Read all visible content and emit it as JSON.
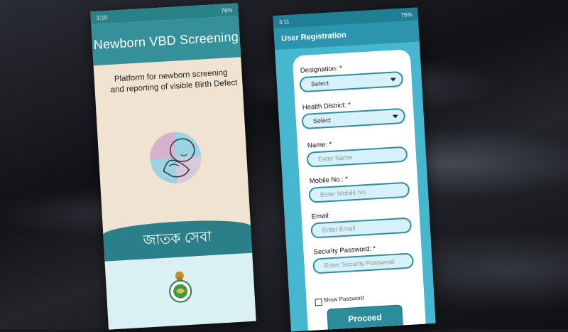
{
  "phone1": {
    "status": {
      "time": "3:10",
      "battery": "76%"
    },
    "header_title": "Newborn VBD Screening",
    "tagline_line1": "Platform for newborn screening",
    "tagline_line2": "and reporting of visible Birth Defect",
    "band_text": "জাতক সেবা"
  },
  "phone2": {
    "status": {
      "time": "3:11",
      "battery": "75%"
    },
    "header_title": "User Registration",
    "form": {
      "designation_label": "Designation: *",
      "designation_value": "Select",
      "district_label": "Health District: *",
      "district_value": "Select",
      "name_label": "Name: *",
      "name_placeholder": "Enter Name",
      "mobile_label": "Mobile No.: *",
      "mobile_placeholder": "Enter Mobile No",
      "email_label": "Email:",
      "email_placeholder": "Enter Email",
      "password_label": "Security Password: *",
      "password_placeholder": "Enter Security Password",
      "show_password_label": "Show Password",
      "proceed_label": "Proceed"
    }
  },
  "colors": {
    "teal_dark": "#2a7f88",
    "teal_header": "#34919a",
    "cream": "#f1e3d2",
    "blue_bg": "#47b6cf",
    "input_fill": "#d7f1fa"
  }
}
